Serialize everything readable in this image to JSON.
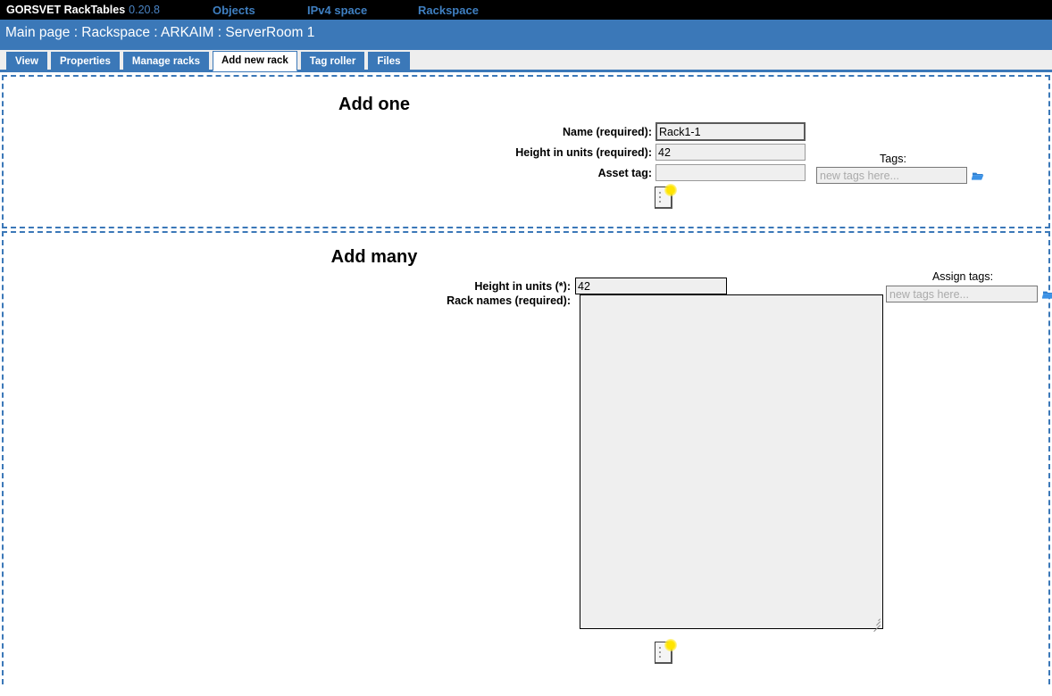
{
  "topnav": {
    "brand_name": "GORSVET RackTables",
    "version": "0.20.8",
    "links": [
      {
        "label": "Objects",
        "name": "nav-objects"
      },
      {
        "label": "IPv4 space",
        "name": "nav-ipv4-space"
      },
      {
        "label": "Rackspace",
        "name": "nav-rackspace"
      }
    ]
  },
  "breadcrumb": {
    "text": "Main page : Rackspace : ARKAIM : ServerRoom 1"
  },
  "tabs": [
    {
      "label": "View",
      "active": false
    },
    {
      "label": "Properties",
      "active": false
    },
    {
      "label": "Manage racks",
      "active": false
    },
    {
      "label": "Add new rack",
      "active": true
    },
    {
      "label": "Tag roller",
      "active": false
    },
    {
      "label": "Files",
      "active": false
    }
  ],
  "add_one": {
    "title": "Add one",
    "name_label": "Name (required):",
    "name_value": "Rack1-1",
    "height_label": "Height in units (required):",
    "height_value": "42",
    "asset_label": "Asset tag:",
    "asset_value": "",
    "tags_label": "Tags:",
    "tags_placeholder": "new tags here...",
    "tags_value": "",
    "submit_icon": "create-document-icon",
    "folder_icon": "open-folder-icon"
  },
  "add_many": {
    "title": "Add many",
    "height_label": "Height in units (*):",
    "height_value": "42",
    "names_label": "Rack names (required):",
    "names_value": "",
    "assign_tags_label": "Assign tags:",
    "tags_placeholder": "new tags here...",
    "tags_value": "",
    "submit_icon": "create-document-icon",
    "folder_icon": "open-folder-icon"
  },
  "colors": {
    "nav_background": "#000000",
    "nav_link": "#3f7fc1",
    "breadcrumb_background": "#3b78b8",
    "tab_background": "#3b78b8",
    "tabstrip_background": "#eeeeee",
    "dashed_border": "#3b78b8",
    "input_background": "#efefef",
    "spark_yellow": "#ffe400"
  }
}
